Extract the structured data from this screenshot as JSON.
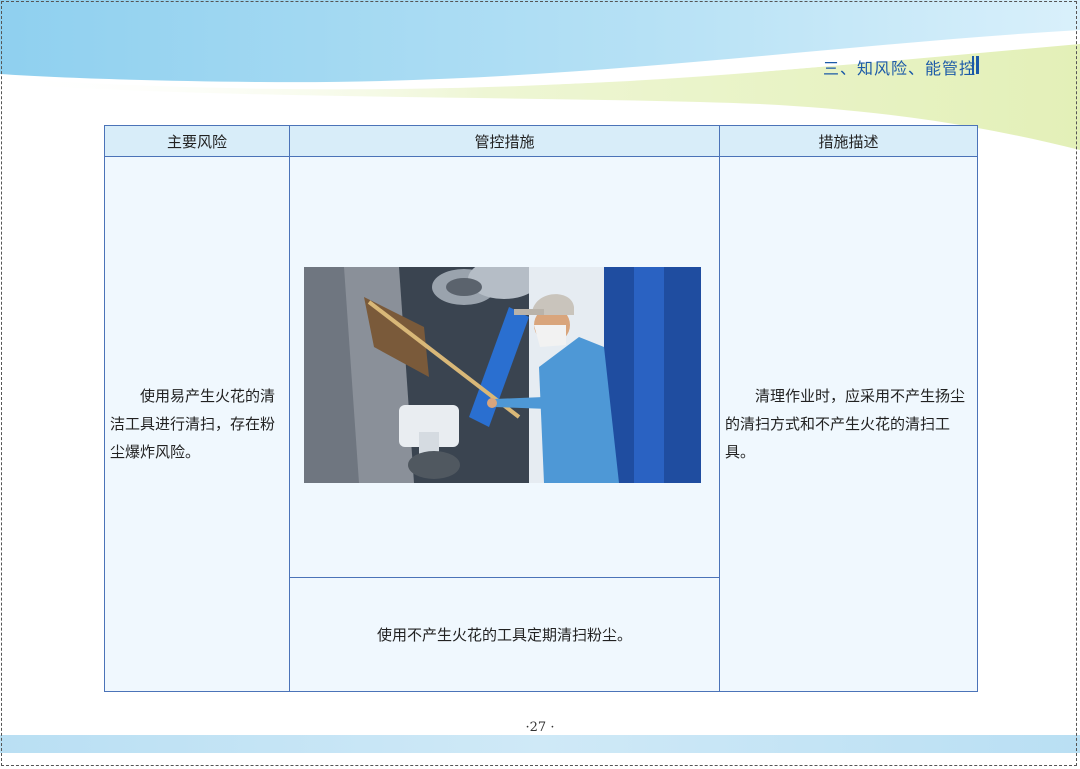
{
  "header": {
    "section_title": "三、知风险、能管控"
  },
  "table": {
    "headers": [
      "主要风险",
      "管控措施",
      "措施描述"
    ],
    "risk_text": "使用易产生火花的清洁工具进行清扫，存在粉尘爆炸风险。",
    "measure_text": "使用不产生火花的工具定期清扫粉尘。",
    "description_text": "清理作业时，应采用不产生扬尘的清扫方式和不产生火花的清扫工具。"
  },
  "footer": {
    "page_number": "·27 ·"
  },
  "colors": {
    "accent_blue": "#1c5aa8",
    "table_border": "#4b73b8",
    "table_header_bg": "#d8edf9",
    "cell_bg": "#f0f8fe"
  }
}
